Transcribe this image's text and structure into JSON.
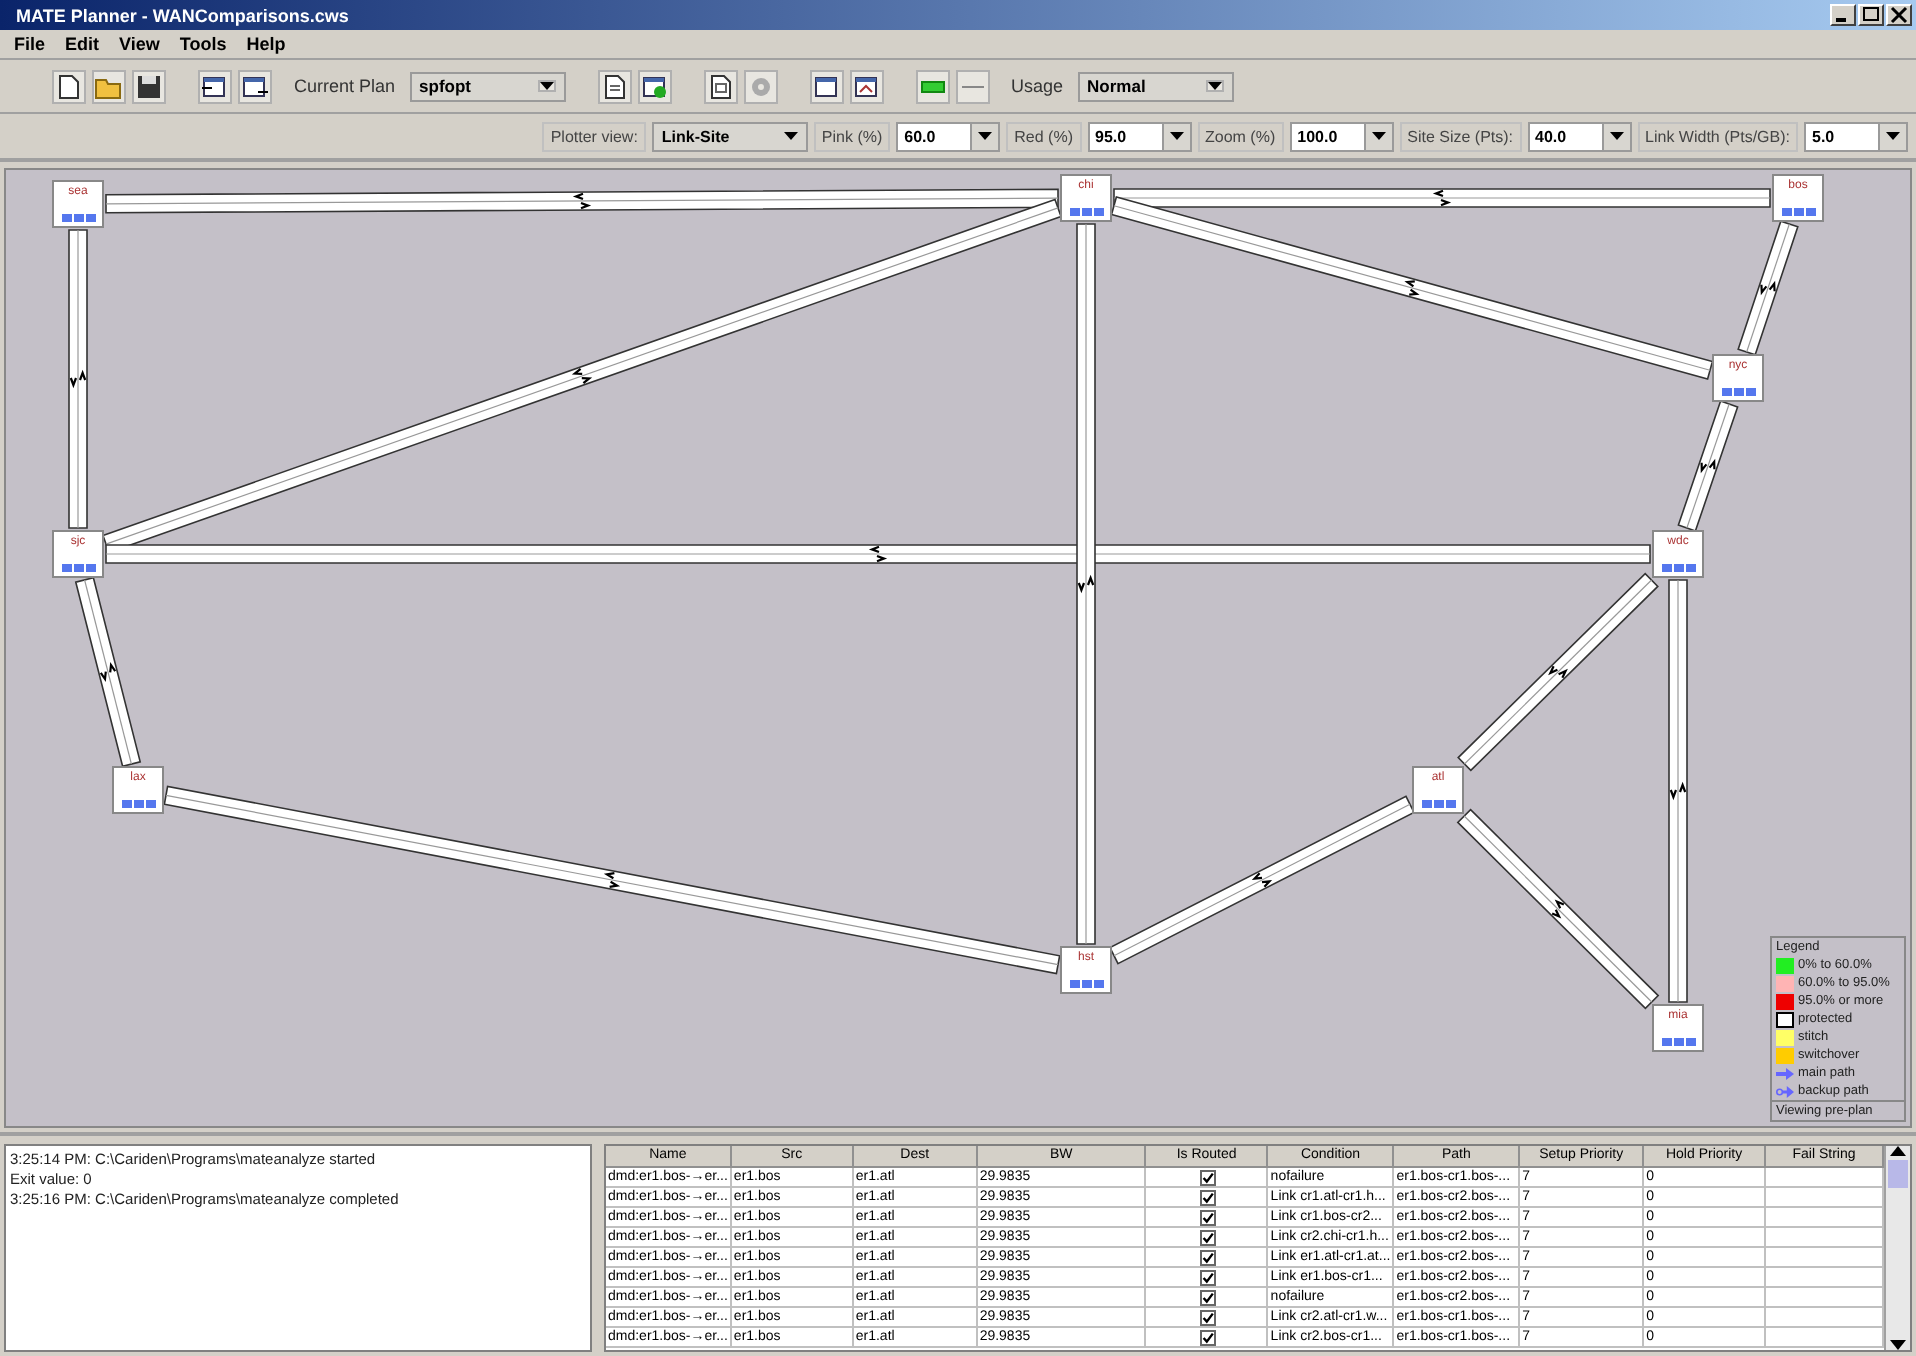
{
  "window": {
    "title": "MATE Planner - WANComparisons.cws"
  },
  "menu": [
    "File",
    "Edit",
    "View",
    "Tools",
    "Help"
  ],
  "toolbar": {
    "plan_label": "Current Plan",
    "plan": "spfopt",
    "usage_label": "Usage",
    "usage": "Normal"
  },
  "plotter_bar": [
    {
      "label": "Plotter view:",
      "value": "Link-Site",
      "kind": "combo"
    },
    {
      "label": "Pink (%)",
      "value": "60.0",
      "kind": "field"
    },
    {
      "label": "Red (%)",
      "value": "95.0",
      "kind": "field"
    },
    {
      "label": "Zoom (%)",
      "value": "100.0",
      "kind": "field"
    },
    {
      "label": "Site Size (Pts):",
      "value": "40.0",
      "kind": "field"
    },
    {
      "label": "Link Width (Pts/GB):",
      "value": "5.0",
      "kind": "field"
    }
  ],
  "sites": [
    {
      "name": "sea"
    },
    {
      "name": "chi"
    },
    {
      "name": "bos"
    },
    {
      "name": "nyc"
    },
    {
      "name": "wdc"
    },
    {
      "name": "sjc"
    },
    {
      "name": "lax"
    },
    {
      "name": "atl"
    },
    {
      "name": "hst"
    },
    {
      "name": "mia"
    }
  ],
  "legend": {
    "title": "Legend",
    "items": [
      {
        "label": "0% to 60.0%",
        "kind": "swatch",
        "color": "#22ee22"
      },
      {
        "label": "60.0% to 95.0%",
        "kind": "swatch",
        "color": "#ffb4b4"
      },
      {
        "label": "95.0% or more",
        "kind": "swatch",
        "color": "#ee0000"
      },
      {
        "label": "protected",
        "kind": "swatch",
        "color": "#ffffff"
      },
      {
        "label": "stitch",
        "kind": "swatch",
        "color": "#ffff66"
      },
      {
        "label": "switchover",
        "kind": "swatch",
        "color": "#ffcc00"
      },
      {
        "label": "main path",
        "kind": "arrow",
        "color": "#6666ff"
      },
      {
        "label": "backup path",
        "kind": "outline-arrow",
        "color": "#6666ff"
      }
    ],
    "status": "Viewing pre-plan"
  },
  "log": [
    "3:25:14 PM: C:\\Cariden\\Programs\\mateanalyze started",
    "Exit value: 0",
    "3:25:16 PM: C:\\Cariden\\Programs\\mateanalyze completed"
  ],
  "table": {
    "columns": [
      "Name",
      "Src",
      "Dest",
      "BW",
      "Is Routed",
      "Condition",
      "Path",
      "Setup Priority",
      "Hold Priority",
      "Fail String"
    ],
    "rows": [
      {
        "name": "dmd:er1.bos-→er...",
        "src": "er1.bos",
        "dest": "er1.atl",
        "bw": "29.9835",
        "is_routed": true,
        "condition": "nofailure",
        "path": "er1.bos-cr1.bos-...",
        "setup_priority": "7",
        "hold_priority": "0"
      },
      {
        "name": "dmd:er1.bos-→er...",
        "src": "er1.bos",
        "dest": "er1.atl",
        "bw": "29.9835",
        "is_routed": true,
        "condition": "Link cr1.atl-cr1.h...",
        "path": "er1.bos-cr2.bos-...",
        "setup_priority": "7",
        "hold_priority": "0"
      },
      {
        "name": "dmd:er1.bos-→er...",
        "src": "er1.bos",
        "dest": "er1.atl",
        "bw": "29.9835",
        "is_routed": true,
        "condition": "Link cr1.bos-cr2...",
        "path": "er1.bos-cr2.bos-...",
        "setup_priority": "7",
        "hold_priority": "0"
      },
      {
        "name": "dmd:er1.bos-→er...",
        "src": "er1.bos",
        "dest": "er1.atl",
        "bw": "29.9835",
        "is_routed": true,
        "condition": "Link cr2.chi-cr1.h...",
        "path": "er1.bos-cr2.bos-...",
        "setup_priority": "7",
        "hold_priority": "0"
      },
      {
        "name": "dmd:er1.bos-→er...",
        "src": "er1.bos",
        "dest": "er1.atl",
        "bw": "29.9835",
        "is_routed": true,
        "condition": "Link er1.atl-cr1.at...",
        "path": "er1.bos-cr2.bos-...",
        "setup_priority": "7",
        "hold_priority": "0"
      },
      {
        "name": "dmd:er1.bos-→er...",
        "src": "er1.bos",
        "dest": "er1.atl",
        "bw": "29.9835",
        "is_routed": true,
        "condition": "Link er1.bos-cr1...",
        "path": "er1.bos-cr2.bos-...",
        "setup_priority": "7",
        "hold_priority": "0"
      },
      {
        "name": "dmd:er1.bos-→er...",
        "src": "er1.bos",
        "dest": "er1.atl",
        "bw": "29.9835",
        "is_routed": true,
        "condition": "nofailure",
        "path": "er1.bos-cr2.bos-...",
        "setup_priority": "7",
        "hold_priority": "0"
      },
      {
        "name": "dmd:er1.bos-→er...",
        "src": "er1.bos",
        "dest": "er1.atl",
        "bw": "29.9835",
        "is_routed": true,
        "condition": "Link cr2.atl-cr1.w...",
        "path": "er1.bos-cr1.bos-...",
        "setup_priority": "7",
        "hold_priority": "0"
      },
      {
        "name": "dmd:er1.bos-→er...",
        "src": "er1.bos",
        "dest": "er1.atl",
        "bw": "29.9835",
        "is_routed": true,
        "condition": "Link cr2.bos-cr1...",
        "path": "er1.bos-cr1.bos-...",
        "setup_priority": "7",
        "hold_priority": "0"
      }
    ]
  }
}
